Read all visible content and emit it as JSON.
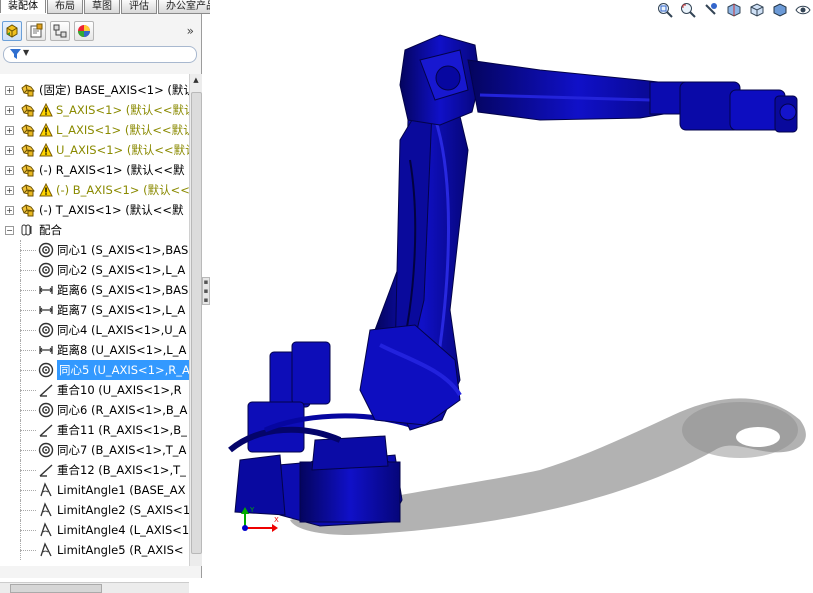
{
  "tabs": [
    "装配体",
    "布局",
    "草图",
    "评估",
    "办公室产品"
  ],
  "panel": {
    "toolbar_icons": [
      "feature-manager-icon",
      "property-manager-icon",
      "configuration-manager-icon",
      "display-manager-icon"
    ],
    "collapse_glyph": "»",
    "filter_icon": "filter-funnel-icon"
  },
  "tree": [
    {
      "label": "(固定) BASE_AXIS<1> (默认<<默",
      "status": "normal",
      "icon": "part-icon",
      "expandable": true
    },
    {
      "label": "S_AXIS<1> (默认<<默认",
      "status": "warning",
      "icon": "part-icon",
      "expandable": true
    },
    {
      "label": "L_AXIS<1> (默认<<默认",
      "status": "warning",
      "icon": "part-icon",
      "expandable": true
    },
    {
      "label": "U_AXIS<1> (默认<<默认",
      "status": "warning",
      "icon": "part-icon",
      "expandable": true
    },
    {
      "label": "(-) R_AXIS<1> (默认<<默",
      "status": "normal",
      "icon": "part-icon",
      "expandable": true
    },
    {
      "label": "(-) B_AXIS<1> (默认<<",
      "status": "warning",
      "icon": "part-icon",
      "expandable": true
    },
    {
      "label": "(-) T_AXIS<1> (默认<<默",
      "status": "normal",
      "icon": "part-icon",
      "expandable": true
    },
    {
      "label": "配合",
      "status": "normal",
      "icon": "mates-folder-icon",
      "expandable": true,
      "expanded": true
    },
    {
      "label": "同心1 (S_AXIS<1>,BAS",
      "status": "normal",
      "icon": "concentric-mate-icon",
      "child": true
    },
    {
      "label": "同心2 (S_AXIS<1>,L_A",
      "status": "normal",
      "icon": "concentric-mate-icon",
      "child": true
    },
    {
      "label": "距离6 (S_AXIS<1>,BAS",
      "status": "normal",
      "icon": "distance-mate-icon",
      "child": true
    },
    {
      "label": "距离7 (S_AXIS<1>,L_A",
      "status": "normal",
      "icon": "distance-mate-icon",
      "child": true
    },
    {
      "label": "同心4 (L_AXIS<1>,U_A",
      "status": "normal",
      "icon": "concentric-mate-icon",
      "child": true
    },
    {
      "label": "距离8 (U_AXIS<1>,L_A",
      "status": "normal",
      "icon": "distance-mate-icon",
      "child": true
    },
    {
      "label": "同心5 (U_AXIS<1>,R_A",
      "status": "selected",
      "icon": "concentric-mate-icon",
      "child": true
    },
    {
      "label": "重合10 (U_AXIS<1>,R",
      "status": "normal",
      "icon": "coincident-mate-icon",
      "child": true
    },
    {
      "label": "同心6 (R_AXIS<1>,B_A",
      "status": "normal",
      "icon": "concentric-mate-icon",
      "child": true
    },
    {
      "label": "重合11 (R_AXIS<1>,B_",
      "status": "normal",
      "icon": "coincident-mate-icon",
      "child": true
    },
    {
      "label": "同心7 (B_AXIS<1>,T_A",
      "status": "normal",
      "icon": "concentric-mate-icon",
      "child": true
    },
    {
      "label": "重合12 (B_AXIS<1>,T_",
      "status": "normal",
      "icon": "coincident-mate-icon",
      "child": true
    },
    {
      "label": "LimitAngle1 (BASE_AX",
      "status": "normal",
      "icon": "limit-angle-icon",
      "child": true
    },
    {
      "label": "LimitAngle2 (S_AXIS<1",
      "status": "normal",
      "icon": "limit-angle-icon",
      "child": true
    },
    {
      "label": "LimitAngle4 (L_AXIS<1",
      "status": "normal",
      "icon": "limit-angle-icon",
      "child": true
    },
    {
      "label": "LimitAngle5 (R_AXIS<",
      "status": "normal",
      "icon": "limit-angle-icon",
      "child": true
    }
  ],
  "view_toolbar": [
    "zoom-to-fit-icon",
    "zoom-area-icon",
    "previous-view-icon",
    "section-view-icon",
    "view-orientation-icon",
    "display-style-icon",
    "hide-show-items-icon"
  ],
  "colors": {
    "model": "#0a0ab4",
    "model_dark": "#05057a",
    "selection": "#3399ff",
    "warning_text": "#8a8a00"
  }
}
